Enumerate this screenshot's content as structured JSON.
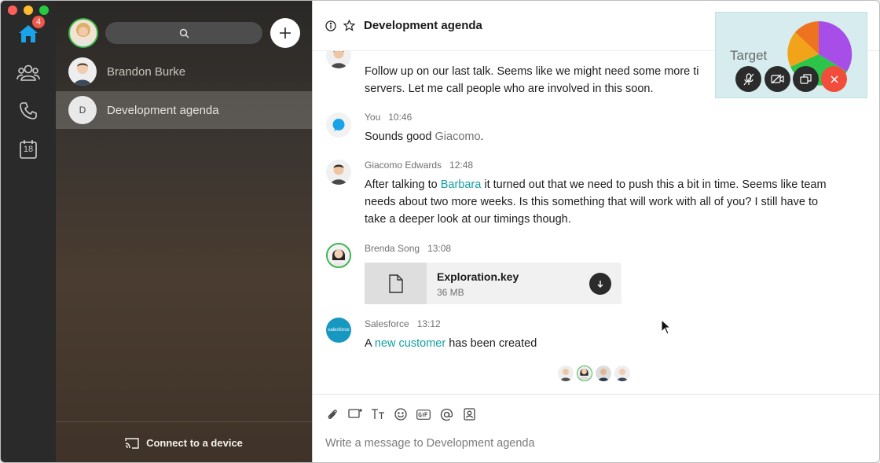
{
  "rail": {
    "home_badge": "4",
    "calendar_day": "18"
  },
  "sidebar": {
    "conversations": [
      {
        "name": "Brandon Burke"
      },
      {
        "name": "Development agenda",
        "initial": "D"
      }
    ],
    "footer_label": "Connect to a device"
  },
  "chat": {
    "title": "Development agenda",
    "messages": [
      {
        "text": "Follow up on our last talk. Seems like we might need some more ti",
        "text2": "servers. Let me call people who are involved in this soon."
      },
      {
        "sender": "You",
        "time": "10:46",
        "text_pre": "Sounds good ",
        "mention": "Giacomo",
        "text_post": "."
      },
      {
        "sender": "Giacomo Edwards",
        "time": "12:48",
        "line1_pre": "After talking to ",
        "line1_link": "Barbara",
        "line1_post": " it turned out that we need to push this a bit in time. Seems like team",
        "line2": "needs about two more weeks. Is this something that will work with all of you? I still have to",
        "line3": "take a deeper look at our timings though."
      },
      {
        "sender": "Brenda Song",
        "time": "13:08",
        "file_name": "Exploration.key",
        "file_size": "36 MB"
      },
      {
        "sender": "Salesforce",
        "time": "13:12",
        "text_pre": "A ",
        "link": "new customer",
        "text_post": " has been created",
        "logo_text": "salesforce"
      }
    ],
    "composer_placeholder": "Write a message to Development agenda"
  },
  "call": {
    "label": "Target"
  },
  "colors": {
    "accent": "#12a0a4",
    "hangup": "#f24c3d",
    "badge": "#f0564a",
    "home_icon": "#1aa3e8"
  }
}
